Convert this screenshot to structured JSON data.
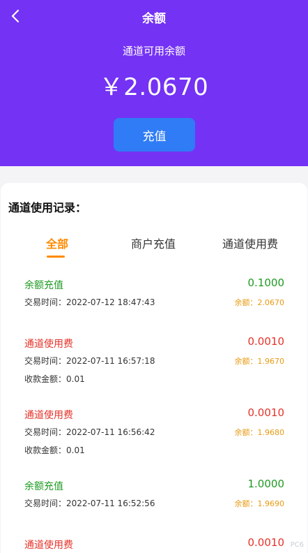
{
  "nav": {
    "title": "余额",
    "back_icon": "chevron-left-icon"
  },
  "balance": {
    "label": "通道可用余额",
    "amount": "￥2.0670"
  },
  "recharge_label": "充值",
  "records": {
    "title": "通道使用记录：",
    "tabs": [
      {
        "label": "全部",
        "active": true
      },
      {
        "label": "商户充值",
        "active": false
      },
      {
        "label": "通道使用费",
        "active": false
      }
    ],
    "items": [
      {
        "type": "余额充值",
        "amount": "0.1000",
        "time": "交易时间：2022-07-12 18:47:43",
        "balance": "余额：2.0670",
        "collect": "",
        "color": "#1e9a21"
      },
      {
        "type": "通道使用费",
        "amount": "0.0010",
        "time": "交易时间：2022-07-11 16:57:18",
        "balance": "余额：1.9670",
        "collect": "收款金额：0.01",
        "color": "#e5332a"
      },
      {
        "type": "通道使用费",
        "amount": "0.0010",
        "time": "交易时间：2022-07-11 16:56:42",
        "balance": "余额：1.9680",
        "collect": "收款金额：0.01",
        "color": "#e5332a"
      },
      {
        "type": "余额充值",
        "amount": "1.0000",
        "time": "交易时间：2022-07-11 16:52:56",
        "balance": "余额：1.9690",
        "collect": "",
        "color": "#1e9a21"
      },
      {
        "type": "通道使用费",
        "amount": "0.0010",
        "time": "",
        "balance": "",
        "collect": "",
        "color": "#e5332a"
      }
    ]
  },
  "colors": {
    "header": "#7432f5",
    "button": "#2f7cf6",
    "accent": "#ff8a00",
    "income": "#1e9a21",
    "expense": "#e5332a",
    "balance_text": "#e79a12"
  },
  "watermark": "PC6"
}
